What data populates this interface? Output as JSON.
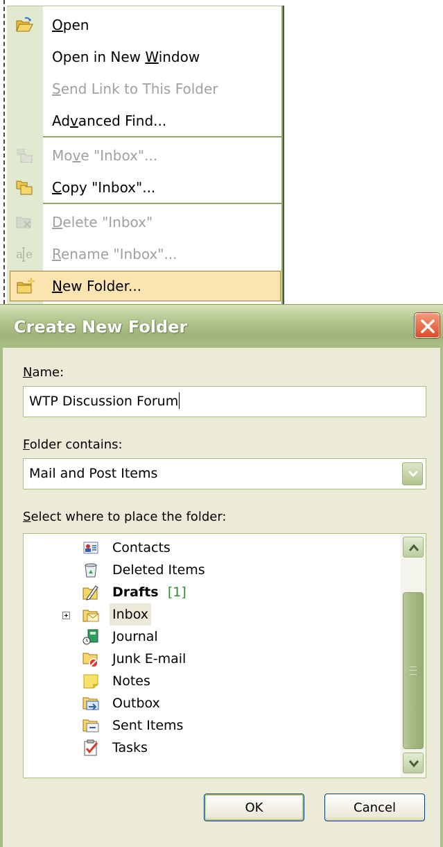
{
  "context_menu": {
    "items": [
      {
        "pre": "",
        "key": "O",
        "post": "pen",
        "enabled": true,
        "icon": "open-folder-icon"
      },
      {
        "pre": "Open in New ",
        "key": "W",
        "post": "indow",
        "enabled": true,
        "icon": ""
      },
      {
        "pre": "",
        "key": "S",
        "post": "end Link to This Folder",
        "enabled": false,
        "icon": ""
      },
      {
        "pre": "Ad",
        "key": "v",
        "post": "anced Find...",
        "enabled": true,
        "icon": ""
      },
      {
        "pre": "Mo",
        "key": "v",
        "post": "e \"Inbox\"...",
        "enabled": false,
        "icon": "move-folder-icon"
      },
      {
        "pre": "",
        "key": "C",
        "post": "opy \"Inbox\"...",
        "enabled": true,
        "icon": "copy-folder-icon"
      },
      {
        "pre": "",
        "key": "D",
        "post": "elete \"Inbox\"",
        "enabled": false,
        "icon": "delete-folder-icon"
      },
      {
        "pre": "",
        "key": "R",
        "post": "ename \"Inbox\"...",
        "enabled": false,
        "icon": "rename-icon"
      },
      {
        "pre": "",
        "key": "N",
        "post": "ew Folder...",
        "enabled": true,
        "icon": "new-folder-icon",
        "highlighted": true
      }
    ]
  },
  "dialog": {
    "title": "Create New Folder",
    "name_label": {
      "key": "N",
      "rest": "ame:"
    },
    "name_value": "WTP Discussion Forum",
    "contains_label": {
      "key": "F",
      "rest": "older contains:"
    },
    "contains_value": "Mail and Post Items",
    "location_label": {
      "key": "S",
      "rest": "elect where to place the folder:"
    },
    "folders": [
      {
        "label": "Contacts",
        "icon": "contacts-icon"
      },
      {
        "label": "Deleted Items",
        "icon": "deleted-items-icon"
      },
      {
        "label": "Drafts",
        "count": "[1]",
        "bold": true,
        "icon": "drafts-icon"
      },
      {
        "label": "Inbox",
        "icon": "inbox-icon",
        "selected": true,
        "expandable": true
      },
      {
        "label": "Journal",
        "icon": "journal-icon"
      },
      {
        "label": "Junk E-mail",
        "icon": "junk-email-icon"
      },
      {
        "label": "Notes",
        "icon": "notes-icon"
      },
      {
        "label": "Outbox",
        "icon": "outbox-icon"
      },
      {
        "label": "Sent Items",
        "icon": "sent-items-icon"
      },
      {
        "label": "Tasks",
        "icon": "tasks-icon"
      }
    ],
    "ok_label": "OK",
    "cancel_label": "Cancel"
  },
  "colors": {
    "titlebar": "#a9bd86",
    "menu_highlight": "#fbe4b0",
    "close_button": "#d94d2b",
    "unread_count": "#2e8b2e"
  }
}
